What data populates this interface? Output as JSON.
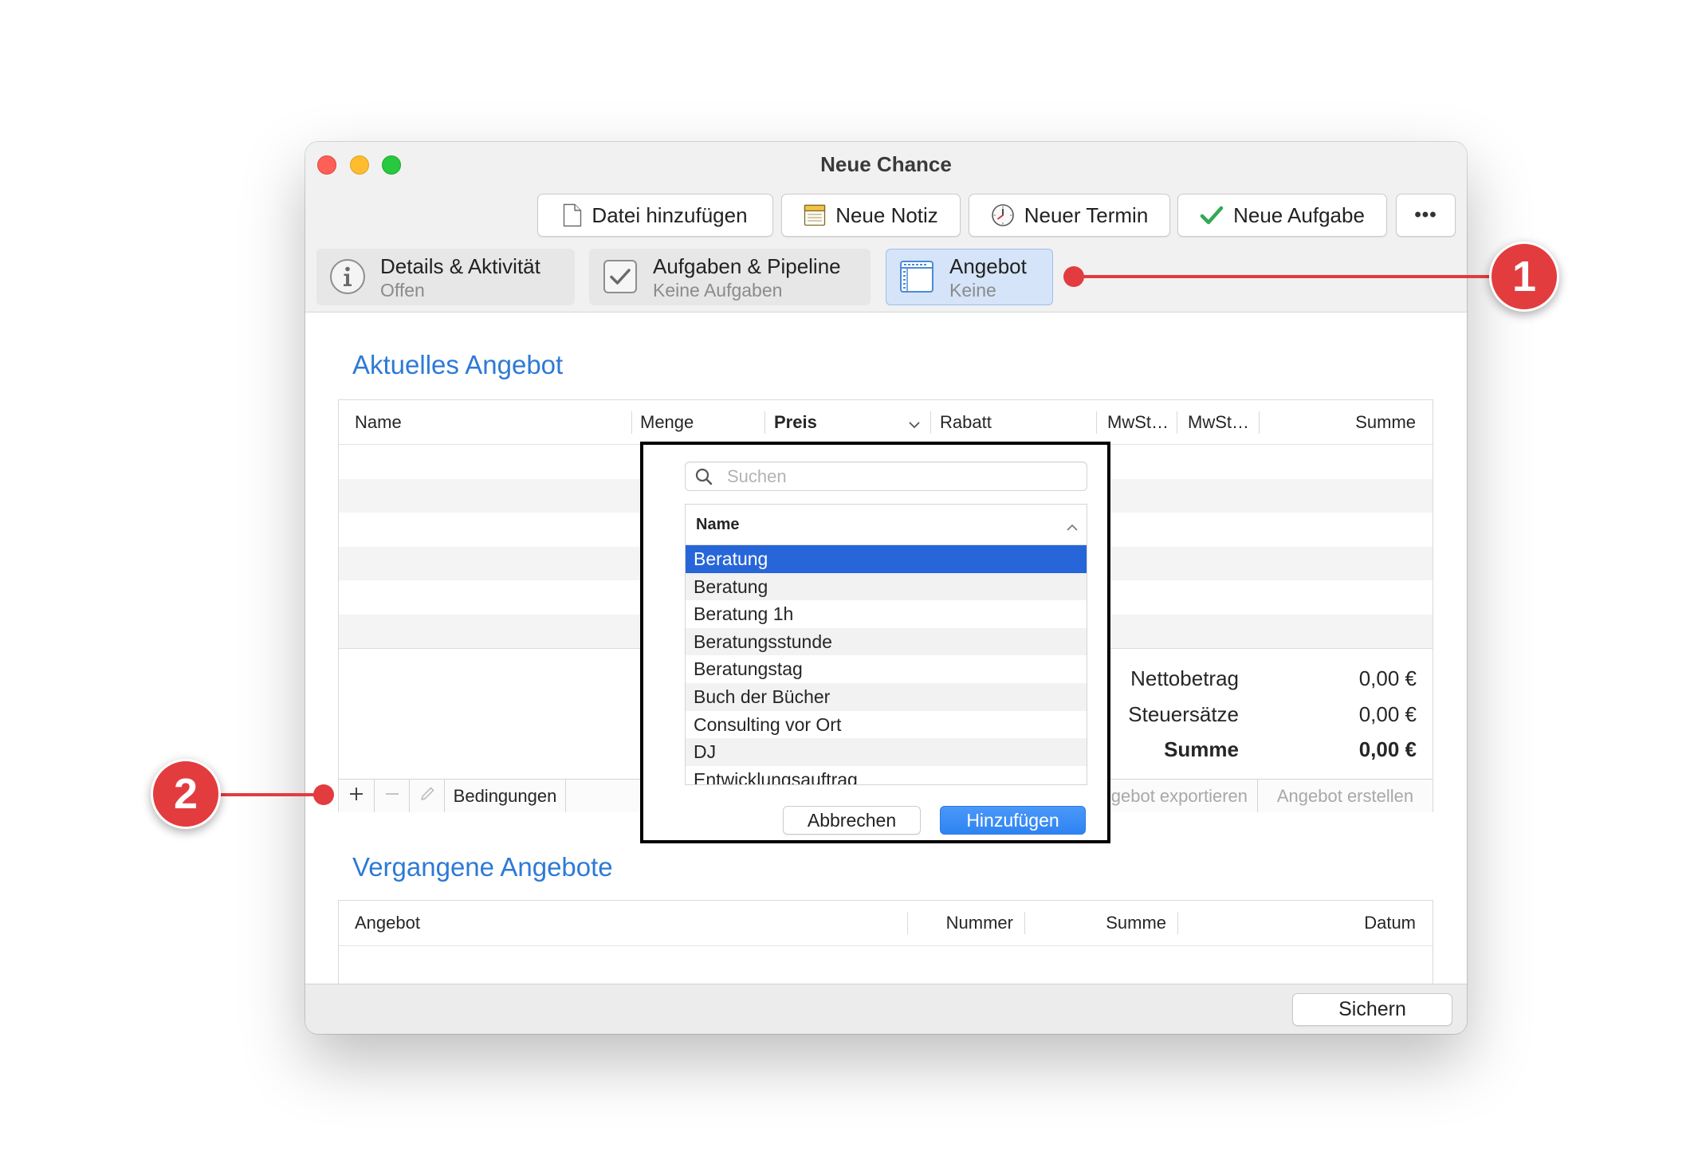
{
  "window": {
    "title": "Neue Chance"
  },
  "toolbar": {
    "buttons": [
      {
        "label": "Datei hinzufügen",
        "icon": "document-icon"
      },
      {
        "label": "Neue Notiz",
        "icon": "note-icon"
      },
      {
        "label": "Neuer Termin",
        "icon": "clock-icon"
      },
      {
        "label": "Neue Aufgabe",
        "icon": "checkmark-icon"
      }
    ],
    "more_label": "•••"
  },
  "tabs": [
    {
      "title": "Details & Aktivität",
      "subtitle": "Offen",
      "icon": "info-icon",
      "selected": false
    },
    {
      "title": "Aufgaben & Pipeline",
      "subtitle": "Keine Aufgaben",
      "icon": "checkbox-icon",
      "selected": false
    },
    {
      "title": "Angebot",
      "subtitle": "Keine",
      "icon": "offer-icon",
      "selected": true
    }
  ],
  "current_offer": {
    "heading": "Aktuelles Angebot",
    "columns": [
      "Name",
      "Menge",
      "Preis",
      "Rabatt",
      "MwSt…",
      "MwSt…",
      "Summe"
    ],
    "totals": [
      {
        "label": "Nettobetrag",
        "value": "0,00 €"
      },
      {
        "label": "Steuersätze",
        "value": "0,00 €"
      },
      {
        "label": "Summe",
        "value": "0,00 €"
      }
    ],
    "actions": {
      "conditions": "Bedingungen",
      "export": "Angebot exportieren",
      "create": "Angebot erstellen"
    }
  },
  "product_picker": {
    "search_placeholder": "Suchen",
    "column": "Name",
    "items": [
      "Beratung",
      "Beratung",
      "Beratung 1h",
      "Beratungsstunde",
      "Beratungstag",
      "Buch der Bücher",
      "Consulting vor Ort",
      "DJ",
      "Entwicklungsauftrag"
    ],
    "selected_index": 0,
    "cancel_label": "Abbrechen",
    "add_label": "Hinzufügen"
  },
  "past_offers": {
    "heading": "Vergangene Angebote",
    "columns": [
      "Angebot",
      "Nummer",
      "Summe",
      "Datum"
    ]
  },
  "footer": {
    "save_label": "Sichern"
  },
  "annotations": [
    {
      "label": "1"
    },
    {
      "label": "2"
    }
  ],
  "colors": {
    "heading": "#2d7ad6",
    "selection": "#2766d8",
    "primary": "#2f84f3",
    "annotation": "#e23c3f",
    "selected_tab": "#d5e4f8"
  }
}
